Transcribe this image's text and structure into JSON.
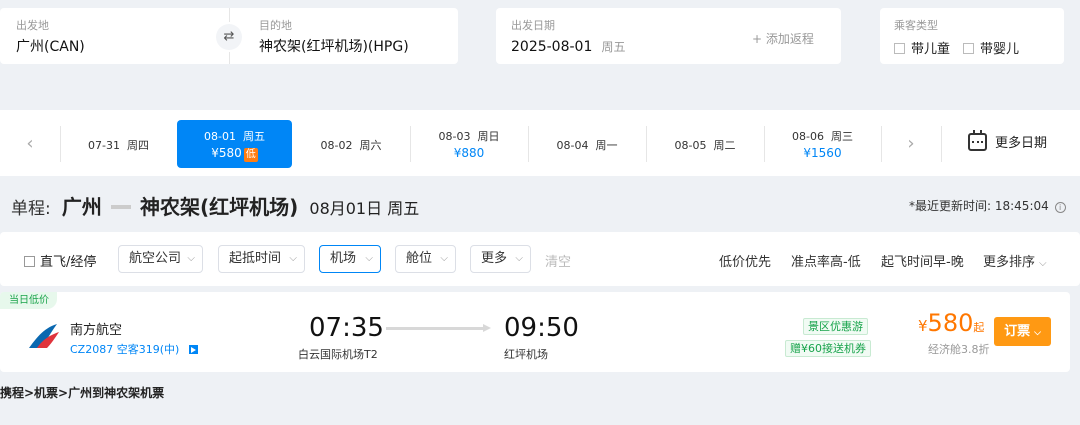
{
  "search": {
    "depart_label": "出发地",
    "depart_value": "广州(CAN)",
    "dest_label": "目的地",
    "dest_value": "神农架(红坪机场)(HPG)",
    "date_label": "出发日期",
    "date_value": "2025-08-01",
    "date_weekday": "周五",
    "add_return": "+ 添加返程",
    "passenger_label": "乘客类型",
    "child": "带儿童",
    "infant": "带婴儿"
  },
  "dates": [
    {
      "date": "07-31",
      "weekday": "周四",
      "price": ""
    },
    {
      "date": "08-01",
      "weekday": "周五",
      "price": "¥580",
      "badge": "低"
    },
    {
      "date": "08-02",
      "weekday": "周六",
      "price": ""
    },
    {
      "date": "08-03",
      "weekday": "周日",
      "price": "¥880"
    },
    {
      "date": "08-04",
      "weekday": "周一",
      "price": ""
    },
    {
      "date": "08-05",
      "weekday": "周二",
      "price": ""
    },
    {
      "date": "08-06",
      "weekday": "周三",
      "price": "¥1560"
    }
  ],
  "more_dates": "更多日期",
  "trip": {
    "type": "单程:",
    "from": "广州",
    "to": "神农架(红坪机场)",
    "date": "08月01日 周五",
    "updated": "*最近更新时间: 18:45:04"
  },
  "filters": {
    "direct": "直飞/经停",
    "airline": "航空公司",
    "time": "起抵时间",
    "airport": "机场",
    "cabin": "舱位",
    "more": "更多",
    "clear": "清空"
  },
  "sorts": {
    "price": "低价优先",
    "ontime": "准点率高-低",
    "depart": "起飞时间早-晚",
    "more": "更多排序"
  },
  "flight": {
    "tag": "当日低价",
    "airline": "南方航空",
    "code": "CZ2087 空客319(中)",
    "dep_time": "07:35",
    "dep_airport": "白云国际机场T2",
    "arr_time": "09:50",
    "arr_airport": "红坪机场",
    "promo1": "景区优惠游",
    "promo2": "赠¥60接送机券",
    "price": "580",
    "price_symbol": "¥",
    "price_suffix": "起",
    "cabin": "经济舱3.8折",
    "book": "订票"
  },
  "breadcrumb": "携程>机票>广州到神农架机票",
  "colors": {
    "accent": "#0086f6",
    "price": "#ff7700",
    "book": "#ff9913"
  }
}
